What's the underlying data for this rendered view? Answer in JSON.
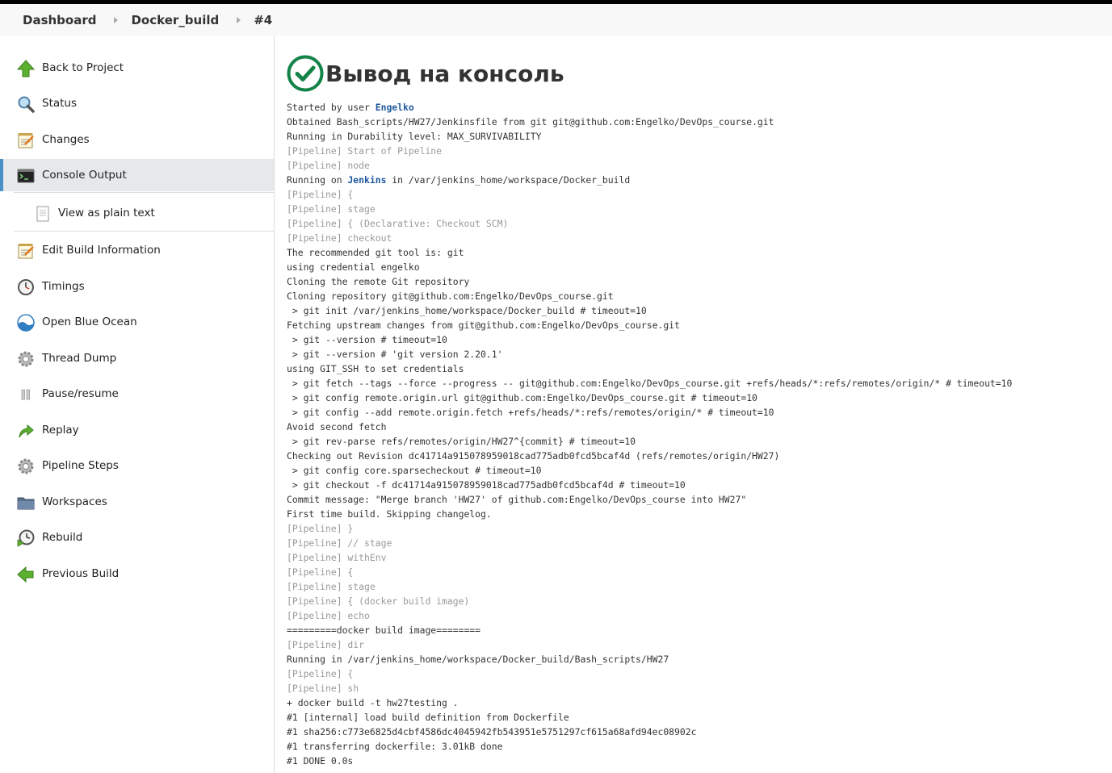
{
  "breadcrumb": [
    "Dashboard",
    "Docker_build",
    "#4"
  ],
  "sidebar": {
    "items": [
      {
        "label": "Back to Project",
        "icon": "up-arrow-icon"
      },
      {
        "label": "Status",
        "icon": "magnifier-icon"
      },
      {
        "label": "Changes",
        "icon": "notepad-icon"
      },
      {
        "label": "Console Output",
        "icon": "terminal-icon",
        "active": true
      },
      {
        "label": "View as plain text",
        "icon": "document-icon"
      },
      {
        "label": "Edit Build Information",
        "icon": "notepad-icon"
      },
      {
        "label": "Timings",
        "icon": "clock-icon"
      },
      {
        "label": "Open Blue Ocean",
        "icon": "blue-ocean-icon"
      },
      {
        "label": "Thread Dump",
        "icon": "gear-icon"
      },
      {
        "label": "Pause/resume",
        "icon": "pause-icon"
      },
      {
        "label": "Replay",
        "icon": "replay-arrow-icon"
      },
      {
        "label": "Pipeline Steps",
        "icon": "gear-icon"
      },
      {
        "label": "Workspaces",
        "icon": "folder-icon"
      },
      {
        "label": "Rebuild",
        "icon": "rebuild-clock-icon"
      },
      {
        "label": "Previous Build",
        "icon": "left-arrow-icon"
      }
    ]
  },
  "main": {
    "title": "Вывод на консоль",
    "status_icon": "success-check-icon",
    "colors": {
      "success": "#138347",
      "link": "#1e5a9e",
      "pipeline": "#999999",
      "active_accent": "#4a90c8"
    },
    "console": [
      {
        "parts": [
          {
            "t": "Started by user "
          },
          {
            "t": "Engelko",
            "link": true
          }
        ]
      },
      {
        "text": "Obtained Bash_scripts/HW27/Jenkinsfile from git git@github.com:Engelko/DevOps_course.git"
      },
      {
        "text": "Running in Durability level: MAX_SURVIVABILITY"
      },
      {
        "text": "[Pipeline] Start of Pipeline",
        "pipeline": true
      },
      {
        "text": "[Pipeline] node",
        "pipeline": true
      },
      {
        "parts": [
          {
            "t": "Running on "
          },
          {
            "t": "Jenkins",
            "link": true
          },
          {
            "t": " in /var/jenkins_home/workspace/Docker_build"
          }
        ]
      },
      {
        "text": "[Pipeline] {",
        "pipeline": true
      },
      {
        "text": "[Pipeline] stage",
        "pipeline": true
      },
      {
        "text": "[Pipeline] { (Declarative: Checkout SCM)",
        "pipeline": true
      },
      {
        "text": "[Pipeline] checkout",
        "pipeline": true
      },
      {
        "text": "The recommended git tool is: git"
      },
      {
        "text": "using credential engelko"
      },
      {
        "text": "Cloning the remote Git repository"
      },
      {
        "text": "Cloning repository git@github.com:Engelko/DevOps_course.git"
      },
      {
        "text": " > git init /var/jenkins_home/workspace/Docker_build # timeout=10"
      },
      {
        "text": "Fetching upstream changes from git@github.com:Engelko/DevOps_course.git"
      },
      {
        "text": " > git --version # timeout=10"
      },
      {
        "text": " > git --version # 'git version 2.20.1'"
      },
      {
        "text": "using GIT_SSH to set credentials"
      },
      {
        "text": " > git fetch --tags --force --progress -- git@github.com:Engelko/DevOps_course.git +refs/heads/*:refs/remotes/origin/* # timeout=10"
      },
      {
        "text": " > git config remote.origin.url git@github.com:Engelko/DevOps_course.git # timeout=10"
      },
      {
        "text": " > git config --add remote.origin.fetch +refs/heads/*:refs/remotes/origin/* # timeout=10"
      },
      {
        "text": "Avoid second fetch"
      },
      {
        "text": " > git rev-parse refs/remotes/origin/HW27^{commit} # timeout=10"
      },
      {
        "text": "Checking out Revision dc41714a915078959018cad775adb0fcd5bcaf4d (refs/remotes/origin/HW27)"
      },
      {
        "text": " > git config core.sparsecheckout # timeout=10"
      },
      {
        "text": " > git checkout -f dc41714a915078959018cad775adb0fcd5bcaf4d # timeout=10"
      },
      {
        "text": "Commit message: \"Merge branch 'HW27' of github.com:Engelko/DevOps_course into HW27\""
      },
      {
        "text": "First time build. Skipping changelog."
      },
      {
        "text": "[Pipeline] }",
        "pipeline": true
      },
      {
        "text": "[Pipeline] // stage",
        "pipeline": true
      },
      {
        "text": "[Pipeline] withEnv",
        "pipeline": true
      },
      {
        "text": "[Pipeline] {",
        "pipeline": true
      },
      {
        "text": "[Pipeline] stage",
        "pipeline": true
      },
      {
        "text": "[Pipeline] { (docker build image)",
        "pipeline": true
      },
      {
        "text": "[Pipeline] echo",
        "pipeline": true
      },
      {
        "text": "=========docker build image========"
      },
      {
        "text": "[Pipeline] dir",
        "pipeline": true
      },
      {
        "text": "Running in /var/jenkins_home/workspace/Docker_build/Bash_scripts/HW27"
      },
      {
        "text": "[Pipeline] {",
        "pipeline": true
      },
      {
        "text": "[Pipeline] sh",
        "pipeline": true
      },
      {
        "text": "+ docker build -t hw27testing ."
      },
      {
        "text": "#1 [internal] load build definition from Dockerfile"
      },
      {
        "text": "#1 sha256:c773e6825d4cbf4586dc4045942fb543951e5751297cf615a68afd94ec08902c"
      },
      {
        "text": "#1 transferring dockerfile: 3.01kB done"
      },
      {
        "text": "#1 DONE 0.0s"
      }
    ]
  }
}
